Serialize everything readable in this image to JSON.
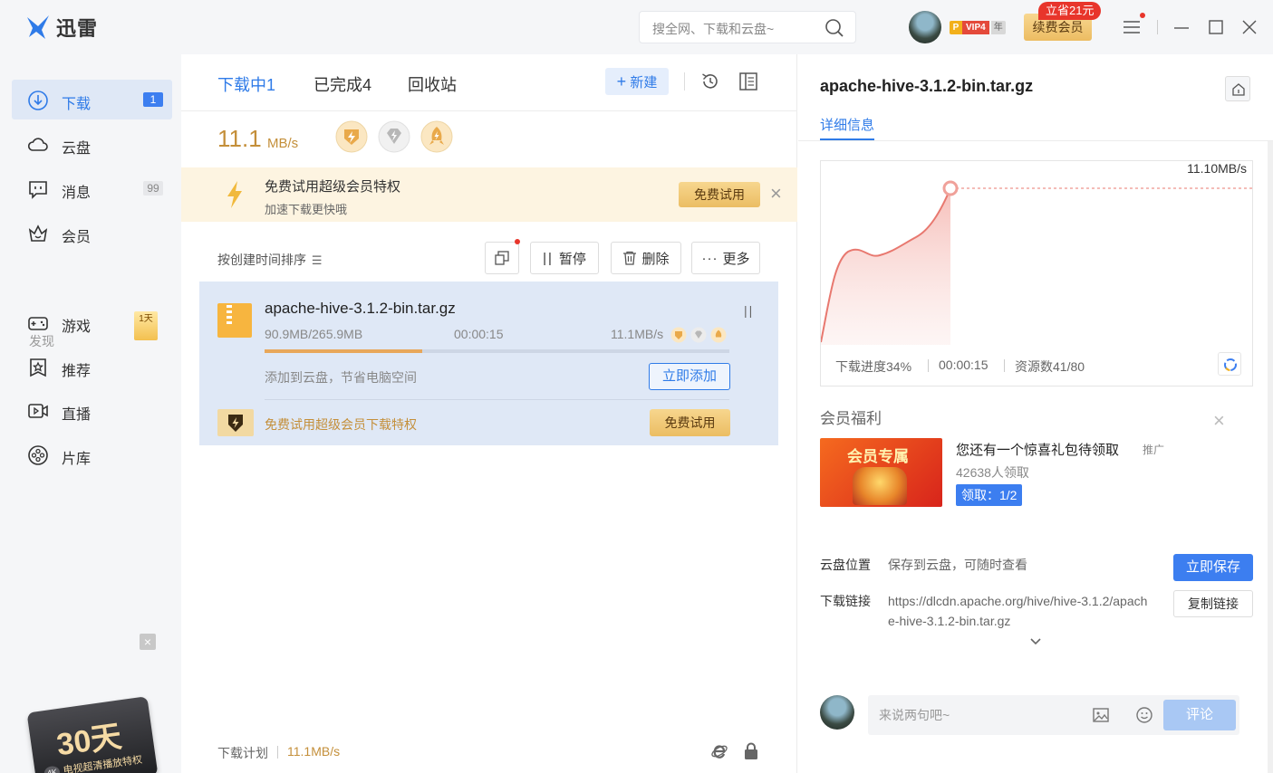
{
  "app": {
    "name": "迅雷"
  },
  "search": {
    "placeholder": "搜全网、下载和云盘~"
  },
  "user": {
    "vip_p": "P",
    "vip_level": "VIP4",
    "vip_year": "年",
    "renew_label": "续费会员",
    "renew_tag": "立省21元"
  },
  "sidebar": {
    "items": [
      {
        "label": "下载",
        "badge": "1"
      },
      {
        "label": "云盘"
      },
      {
        "label": "消息",
        "badge": "99"
      },
      {
        "label": "会员"
      }
    ],
    "discover_label": "发现",
    "discover_items": [
      {
        "label": "游戏",
        "badge": "1天"
      },
      {
        "label": "推荐"
      },
      {
        "label": "直播"
      },
      {
        "label": "片库"
      }
    ],
    "promo": {
      "days": "30天",
      "text": "电视超清播放特权",
      "tag": "4K",
      "close": "×"
    }
  },
  "downloads": {
    "tabs": [
      "下载中1",
      "已完成4",
      "回收站"
    ],
    "new_label": "新建",
    "speed_value": "11.1",
    "speed_unit": "MB/s",
    "trial_banner": {
      "title": "免费试用超级会员特权",
      "subtitle": "加速下载更快哦",
      "button": "免费试用",
      "close": "×"
    },
    "sort_label": "按创建时间排序",
    "toolbar": {
      "pause": "暂停",
      "delete": "删除",
      "more": "更多"
    },
    "task": {
      "name": "apache-hive-3.1.2-bin.tar.gz",
      "size": "90.9MB/265.9MB",
      "elapsed": "00:00:15",
      "speed": "11.1MB/s",
      "progress": 0.34,
      "cloud_text": "添加到云盘，节省电脑空间",
      "add_button": "立即添加",
      "vip_text": "免费试用超级会员下载特权",
      "vip_button": "免费试用"
    },
    "plan_label": "下载计划",
    "plan_speed": "11.1MB/s"
  },
  "detail": {
    "title": "apache-hive-3.1.2-bin.tar.gz",
    "tab": "详细信息",
    "chart_speed": "11.10MB/s",
    "stats": {
      "progress": "下载进度34%",
      "elapsed": "00:00:15",
      "sources": "资源数41/80"
    },
    "benefit": {
      "title": "会员福利",
      "image_text": "会员专属",
      "headline": "您还有一个惊喜礼包待领取",
      "ad_tag": "推广",
      "count": "42638人领取",
      "claim": "领取：1/2"
    },
    "cloud": {
      "label": "云盘位置",
      "value": "保存到云盘，可随时查看",
      "button": "立即保存"
    },
    "link": {
      "label": "下载链接",
      "value": "https://dlcdn.apache.org/hive/hive-3.1.2/apache-hive-3.1.2-bin.tar.gz",
      "button": "复制链接"
    },
    "comment": {
      "placeholder": "来说两句吧~",
      "submit": "评论"
    }
  },
  "colors": {
    "accent": "#2f7be8",
    "gold": "#c48f3a",
    "chart_line": "#e8786f"
  }
}
